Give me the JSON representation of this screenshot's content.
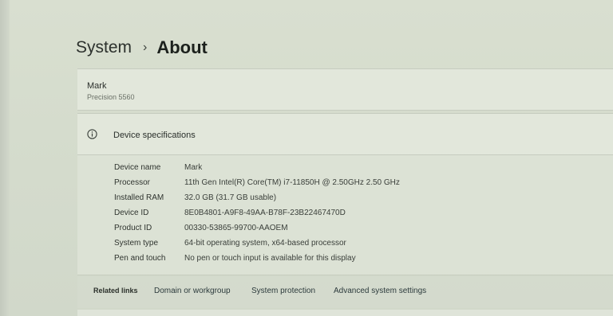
{
  "breadcrumb": {
    "parent": "System",
    "separator": "›",
    "current": "About"
  },
  "device": {
    "name": "Mark",
    "model": "Precision 5560"
  },
  "specs": {
    "icon": "info-icon",
    "title": "Device specifications",
    "rows": [
      {
        "label": "Device name",
        "value": "Mark"
      },
      {
        "label": "Processor",
        "value": "11th Gen Intel(R) Core(TM) i7-11850H @ 2.50GHz   2.50 GHz"
      },
      {
        "label": "Installed RAM",
        "value": "32.0 GB (31.7 GB usable)"
      },
      {
        "label": "Device ID",
        "value": "8E0B4801-A9F8-49AA-B78F-23B22467470D"
      },
      {
        "label": "Product ID",
        "value": "00330-53865-99700-AAOEM"
      },
      {
        "label": "System type",
        "value": "64-bit operating system, x64-based processor"
      },
      {
        "label": "Pen and touch",
        "value": "No pen or touch input is available for this display"
      }
    ]
  },
  "related": {
    "label": "Related links",
    "links": [
      "Domain or workgroup",
      "System protection",
      "Advanced system settings"
    ]
  }
}
